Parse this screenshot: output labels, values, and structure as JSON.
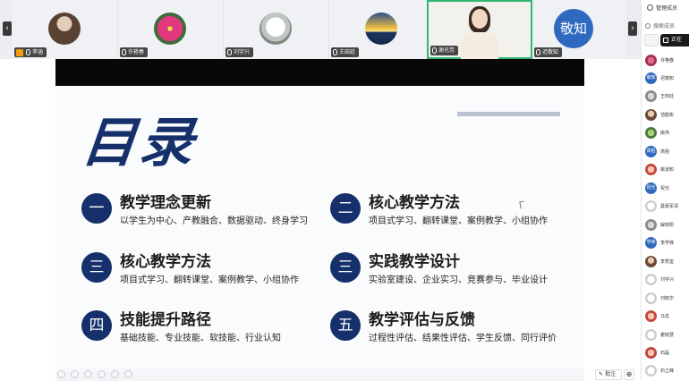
{
  "participants": [
    {
      "name": "李涵",
      "avatar": "woman-dark",
      "host_badge": true
    },
    {
      "name": "许艳春",
      "avatar": "flower"
    },
    {
      "name": "刘宇兴",
      "avatar": "sketch"
    },
    {
      "name": "王田廷",
      "avatar": "sunset"
    },
    {
      "name": "谢光芳",
      "avatar": "video",
      "active": true
    },
    {
      "name": "迟敬知",
      "avatar": "initials",
      "initials": "敬知"
    }
  ],
  "sidebar": {
    "title": "管理成员",
    "share_label": "正在",
    "search_placeholder": "搜索成员",
    "members": [
      {
        "name": "许艳春",
        "avatar": "pink"
      },
      {
        "name": "迟敬知",
        "avatar": "blue",
        "initials": "敬知"
      },
      {
        "name": "王田廷",
        "avatar": "gray"
      },
      {
        "name": "范胜彬",
        "avatar": "brown"
      },
      {
        "name": "姚伟",
        "avatar": "green"
      },
      {
        "name": "高柏",
        "avatar": "blue",
        "initials": "高柏"
      },
      {
        "name": "姚道知",
        "avatar": "red"
      },
      {
        "name": "祝光",
        "avatar": "blue",
        "initials": "祝光"
      },
      {
        "name": "曼晨军清",
        "avatar": "white"
      },
      {
        "name": "解晓阳",
        "avatar": "gray"
      },
      {
        "name": "李学锋",
        "avatar": "blue",
        "initials": "学锋"
      },
      {
        "name": "李秀玺",
        "avatar": "brown"
      },
      {
        "name": "刘宇兴",
        "avatar": "white"
      },
      {
        "name": "刘晓华",
        "avatar": "white"
      },
      {
        "name": "马龙",
        "avatar": "red"
      },
      {
        "name": "瞿晓慧",
        "avatar": "white"
      },
      {
        "name": "石磊",
        "avatar": "red"
      },
      {
        "name": "石立峰",
        "avatar": "white"
      }
    ]
  },
  "slide": {
    "title": "目录",
    "items": [
      {
        "num": "一",
        "title": "教学理念更新",
        "sub": "以学生为中心、产教融合、数据驱动、终身学习"
      },
      {
        "num": "二",
        "title": "核心教学方法",
        "sub": "项目式学习、翻转课堂、案例教学、小组协作"
      },
      {
        "num": "三",
        "title": "核心教学方法",
        "sub": "项目式学习、翻转课堂、案例教学、小组协作"
      },
      {
        "num": "三",
        "title": "实践教学设计",
        "sub": "实验室建设、企业实习、竞赛参与、毕业设计"
      },
      {
        "num": "四",
        "title": "技能提升路径",
        "sub": "基础技能、专业技能、软技能、行业认知"
      },
      {
        "num": "五",
        "title": "教学评估与反馈",
        "sub": "过程性评估、结果性评估、学生反馈、同行评价"
      }
    ]
  },
  "toolbar": {
    "annotate_label": "批注",
    "prev_icon": "chevron-left-icon",
    "next_icon": "chevron-right-icon"
  },
  "colors": {
    "accent_navy": "#15306b",
    "active_border": "#2fb873",
    "avatar_blue": "#2f69bf"
  }
}
